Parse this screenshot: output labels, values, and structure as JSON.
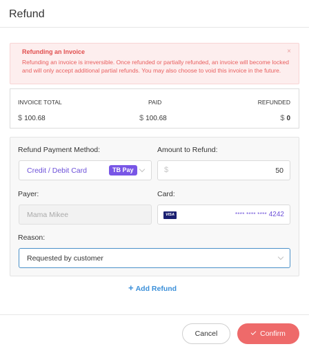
{
  "dialog": {
    "title": "Refund"
  },
  "alert": {
    "title": "Refunding an Invoice",
    "body": "Refunding an invoice is irreversible. Once refunded or partially refunded, an invoice will become locked and will only accept additional partial refunds. You may also choose to void this invoice in the future.",
    "close_icon": "×"
  },
  "totals": {
    "headers": {
      "invoice_total": "INVOICE TOTAL",
      "paid": "PAID",
      "refunded": "REFUNDED"
    },
    "currency": "$",
    "invoice_total": "100.68",
    "paid": "100.68",
    "refunded": "0"
  },
  "form": {
    "payment_method": {
      "label": "Refund Payment Method:",
      "value": "Credit / Debit Card",
      "badge": "TB Pay"
    },
    "amount": {
      "label": "Amount to Refund:",
      "currency": "$",
      "value": "50"
    },
    "payer": {
      "label": "Payer:",
      "placeholder": "Mama Mikee"
    },
    "card": {
      "label": "Card:",
      "brand": "VISA",
      "masked": "**** **** ****",
      "last4": "4242"
    },
    "reason": {
      "label": "Reason:",
      "value": "Requested by customer"
    }
  },
  "add_refund": {
    "icon": "+",
    "label": "Add Refund"
  },
  "footer": {
    "cancel_label": "Cancel",
    "confirm_label": "Confirm"
  },
  "colors": {
    "accent_purple": "#7856e6",
    "link_blue": "#3a8fd9",
    "confirm_red": "#ee6a6a",
    "alert_red": "#e04e4e",
    "alert_bg": "#fdeeee"
  }
}
